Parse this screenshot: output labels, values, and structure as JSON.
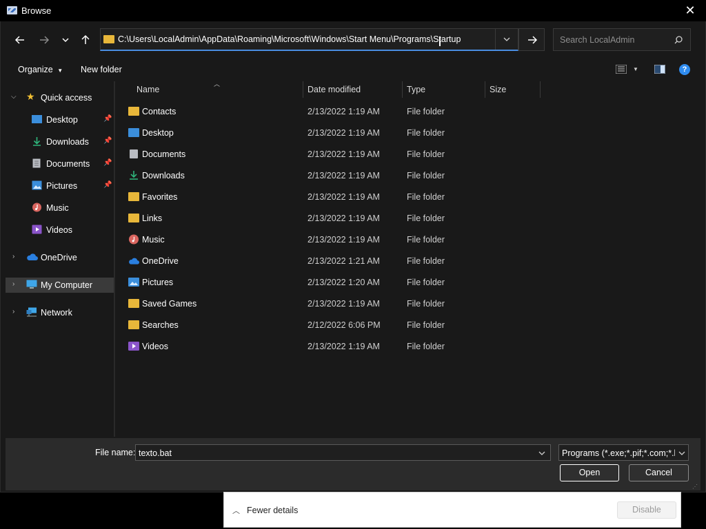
{
  "window": {
    "title": "Browse",
    "close_glyph": "✕"
  },
  "address": {
    "path": "C:\\Users\\LocalAdmin\\AppData\\Roaming\\Microsoft\\Windows\\Start Menu\\Programs\\Startup",
    "search_placeholder": "Search LocalAdmin"
  },
  "toolbar": {
    "organize_label": "Organize",
    "new_folder_label": "New folder",
    "help_glyph": "?"
  },
  "nav_pane": {
    "items": [
      {
        "label": "Quick access",
        "icon": "star-icon",
        "color": "#f2c033"
      },
      {
        "label": "Desktop",
        "icon": "desktop-icon",
        "color": "#3b8edb",
        "pinned": true
      },
      {
        "label": "Downloads",
        "icon": "download-icon",
        "color": "#2fb67c",
        "pinned": true
      },
      {
        "label": "Documents",
        "icon": "document-icon",
        "color": "#b9bcc2",
        "pinned": true
      },
      {
        "label": "Pictures",
        "icon": "pictures-icon",
        "color": "#3b8edb",
        "pinned": true
      },
      {
        "label": "Music",
        "icon": "music-icon",
        "color": "#d9655f"
      },
      {
        "label": "Videos",
        "icon": "videos-icon",
        "color": "#8a54c9"
      },
      {
        "label": "OneDrive",
        "icon": "cloud-icon",
        "color": "#2a7fe0"
      },
      {
        "label": "My Computer",
        "icon": "computer-icon",
        "color": "#3fa6e8",
        "selected": true
      },
      {
        "label": "Network",
        "icon": "network-icon",
        "color": "#3fa6e8"
      }
    ]
  },
  "columns": {
    "name": "Name",
    "date": "Date modified",
    "type": "Type",
    "size": "Size"
  },
  "files": [
    {
      "name": "Contacts",
      "date": "2/13/2022 1:19 AM",
      "type": "File folder",
      "icon": "folder-icon",
      "color": "#e8b73a"
    },
    {
      "name": "Desktop",
      "date": "2/13/2022 1:19 AM",
      "type": "File folder",
      "icon": "desktop-icon",
      "color": "#3b8edb"
    },
    {
      "name": "Documents",
      "date": "2/13/2022 1:19 AM",
      "type": "File folder",
      "icon": "document-icon",
      "color": "#b9bcc2"
    },
    {
      "name": "Downloads",
      "date": "2/13/2022 1:19 AM",
      "type": "File folder",
      "icon": "download-icon",
      "color": "#2fb67c"
    },
    {
      "name": "Favorites",
      "date": "2/13/2022 1:19 AM",
      "type": "File folder",
      "icon": "folder-icon",
      "color": "#e8b73a"
    },
    {
      "name": "Links",
      "date": "2/13/2022 1:19 AM",
      "type": "File folder",
      "icon": "folder-icon",
      "color": "#e8b73a"
    },
    {
      "name": "Music",
      "date": "2/13/2022 1:19 AM",
      "type": "File folder",
      "icon": "music-icon",
      "color": "#d9655f"
    },
    {
      "name": "OneDrive",
      "date": "2/13/2022 1:21 AM",
      "type": "File folder",
      "icon": "cloud-icon",
      "color": "#2a7fe0"
    },
    {
      "name": "Pictures",
      "date": "2/13/2022 1:20 AM",
      "type": "File folder",
      "icon": "pictures-icon",
      "color": "#3b8edb"
    },
    {
      "name": "Saved Games",
      "date": "2/13/2022 1:19 AM",
      "type": "File folder",
      "icon": "folder-icon",
      "color": "#e8b73a"
    },
    {
      "name": "Searches",
      "date": "2/12/2022 6:06 PM",
      "type": "File folder",
      "icon": "folder-icon",
      "color": "#e8b73a"
    },
    {
      "name": "Videos",
      "date": "2/13/2022 1:19 AM",
      "type": "File folder",
      "icon": "videos-icon",
      "color": "#8a54c9"
    }
  ],
  "footer": {
    "file_name_label": "File name:",
    "file_name_value": "texto.bat",
    "filter_value": "Programs (*.exe;*.pif;*.com;*.bat;*.cmd)",
    "open_label": "Open",
    "cancel_label": "Cancel"
  },
  "details_panel": {
    "fewer_details_label": "Fewer details",
    "disable_label": "Disable"
  }
}
